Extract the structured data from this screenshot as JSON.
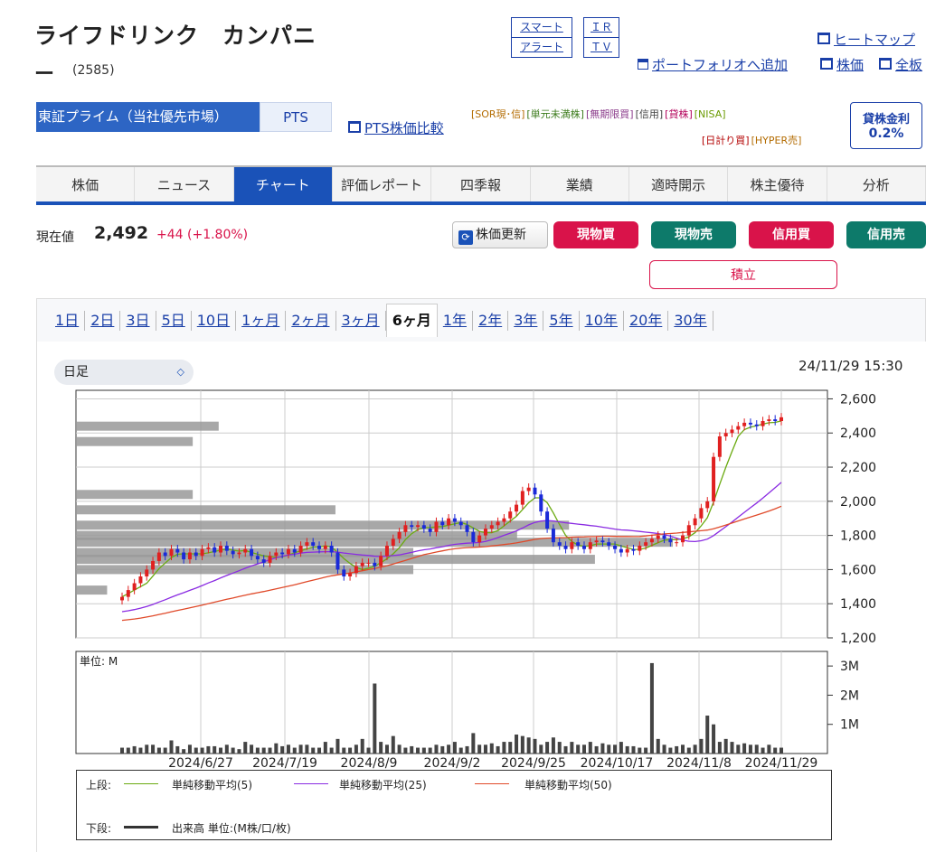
{
  "header": {
    "company_name_line1": "ライフドリンク　カンパニ",
    "company_name_line2": "ー",
    "code": "(2585)",
    "smart_alert_1": "スマート",
    "smart_alert_2": "アラート",
    "ir_1": "ＩＲ",
    "ir_2": "ＴＶ",
    "heatmap": "ヒートマップ",
    "portfolio_add": "ポートフォリオへ追加",
    "stock_price_link": "株価",
    "all_link": "全板"
  },
  "market": {
    "primary": "東証プライム（当社優先市場）",
    "pts": "PTS",
    "pts_compare": "PTS株価比較"
  },
  "tags": {
    "row1": [
      "[SOR現･信]",
      "[単元未満株]",
      "[無期限買]",
      "[信用]",
      "[貸株]",
      "[NISA]"
    ],
    "row2": [
      "[日計り買]",
      "[HYPER売]"
    ],
    "row1_colors": [
      "#b36b00",
      "#3a7a1a",
      "#8a3a8a",
      "#444",
      "#b3005a",
      "#6a9a00"
    ],
    "row2_colors": [
      "#b30000",
      "#b36b00"
    ]
  },
  "lending": {
    "label": "貸株金利",
    "value": "0.2%"
  },
  "tabs": [
    {
      "label": "株価",
      "active": false
    },
    {
      "label": "ニュース",
      "active": false
    },
    {
      "label": "チャート",
      "active": true
    },
    {
      "label": "評価レポート",
      "active": false
    },
    {
      "label": "四季報",
      "active": false
    },
    {
      "label": "業績",
      "active": false
    },
    {
      "label": "適時開示",
      "active": false
    },
    {
      "label": "株主優待",
      "active": false
    },
    {
      "label": "分析",
      "active": false
    }
  ],
  "quote": {
    "label": "現在値",
    "price": "2,492",
    "change": "+44 (+1.80%)"
  },
  "actions": {
    "refresh": "株価更新",
    "spot_buy": "現物買",
    "spot_sell": "現物売",
    "margin_buy": "信用買",
    "margin_sell": "信用売",
    "accumulate": "積立"
  },
  "colors": {
    "buy": "#d9134a",
    "sell": "#0d7a6a",
    "accent": "#1a52b8"
  },
  "ranges": [
    {
      "label": "1日",
      "active": false
    },
    {
      "label": "2日",
      "active": false
    },
    {
      "label": "3日",
      "active": false
    },
    {
      "label": "5日",
      "active": false
    },
    {
      "label": "10日",
      "active": false
    },
    {
      "label": "1ヶ月",
      "active": false
    },
    {
      "label": "2ヶ月",
      "active": false
    },
    {
      "label": "3ヶ月",
      "active": false
    },
    {
      "label": "6ヶ月",
      "active": true
    },
    {
      "label": "1年",
      "active": false
    },
    {
      "label": "2年",
      "active": false
    },
    {
      "label": "3年",
      "active": false
    },
    {
      "label": "5年",
      "active": false
    },
    {
      "label": "10年",
      "active": false
    },
    {
      "label": "20年",
      "active": false
    },
    {
      "label": "30年",
      "active": false
    }
  ],
  "chart_controls": {
    "interval": "日足",
    "timestamp": "24/11/29 15:30"
  },
  "chart_data": {
    "type": "candlestick",
    "x_ticks": [
      "2024/6/27",
      "2024/7/19",
      "2024/8/9",
      "2024/9/2",
      "2024/9/25",
      "2024/10/17",
      "2024/11/8",
      "2024/11/29"
    ],
    "price_ticks": [
      "2,600",
      "2,400",
      "2,200",
      "2,000",
      "1,800",
      "1,600",
      "1,400",
      "1,200"
    ],
    "ylim": [
      1200,
      2650
    ],
    "volume_unit_label": "単位: M",
    "volume_ticks": [
      "3M",
      "2M",
      "1M"
    ],
    "volume_ylim": [
      0,
      3.5
    ],
    "closes": [
      1440,
      1480,
      1520,
      1560,
      1600,
      1650,
      1700,
      1680,
      1720,
      1700,
      1660,
      1700,
      1680,
      1720,
      1730,
      1700,
      1740,
      1710,
      1690,
      1700,
      1720,
      1680,
      1660,
      1640,
      1680,
      1700,
      1690,
      1720,
      1700,
      1740,
      1760,
      1740,
      1720,
      1740,
      1700,
      1600,
      1560,
      1580,
      1620,
      1640,
      1640,
      1620,
      1680,
      1740,
      1780,
      1820,
      1860,
      1850,
      1860,
      1840,
      1820,
      1880,
      1860,
      1900,
      1880,
      1860,
      1820,
      1760,
      1800,
      1840,
      1860,
      1880,
      1900,
      1940,
      1980,
      2060,
      2080,
      2040,
      1940,
      1840,
      1760,
      1740,
      1720,
      1760,
      1740,
      1720,
      1760,
      1770,
      1760,
      1740,
      1720,
      1700,
      1720,
      1710,
      1740,
      1760,
      1780,
      1800,
      1780,
      1760,
      1760,
      1800,
      1860,
      1900,
      1960,
      2000,
      2260,
      2380,
      2400,
      2420,
      2440,
      2460,
      2450,
      2440,
      2470,
      2480,
      2470,
      2492
    ],
    "volumes": [
      0.2,
      0.2,
      0.25,
      0.2,
      0.3,
      0.3,
      0.2,
      0.2,
      0.45,
      0.25,
      0.15,
      0.3,
      0.2,
      0.2,
      0.25,
      0.25,
      0.2,
      0.3,
      0.2,
      0.15,
      0.4,
      0.3,
      0.2,
      0.2,
      0.2,
      0.35,
      0.25,
      0.3,
      0.2,
      0.3,
      0.3,
      0.2,
      0.2,
      0.4,
      0.2,
      0.5,
      0.2,
      0.2,
      0.3,
      0.5,
      0.2,
      2.4,
      0.4,
      0.3,
      0.6,
      0.3,
      0.2,
      0.25,
      0.2,
      0.2,
      0.2,
      0.3,
      0.25,
      0.3,
      0.4,
      0.2,
      0.25,
      0.7,
      0.3,
      0.3,
      0.35,
      0.25,
      0.4,
      0.4,
      0.65,
      0.6,
      0.55,
      0.5,
      0.3,
      0.4,
      0.55,
      0.4,
      0.25,
      0.4,
      0.3,
      0.3,
      0.4,
      0.25,
      0.35,
      0.3,
      0.3,
      0.4,
      0.25,
      0.25,
      0.2,
      0.2,
      3.1,
      0.5,
      0.3,
      0.2,
      0.25,
      0.3,
      0.2,
      0.3,
      0.5,
      1.3,
      1.0,
      0.4,
      0.5,
      0.4,
      0.3,
      0.35,
      0.3,
      0.3,
      0.2,
      0.3,
      0.2,
      0.2
    ],
    "ma5_color": "#6aaa10",
    "ma25_color": "#8a2be2",
    "ma50_color": "#e04a2a",
    "volume_profile": [
      {
        "price": 2440,
        "value": 0.55
      },
      {
        "price": 2350,
        "value": 0.45
      },
      {
        "price": 2040,
        "value": 0.45
      },
      {
        "price": 1950,
        "value": 1.0
      },
      {
        "price": 1860,
        "value": 1.9
      },
      {
        "price": 1800,
        "value": 1.7
      },
      {
        "price": 1760,
        "value": 2.3
      },
      {
        "price": 1700,
        "value": 1.3
      },
      {
        "price": 1660,
        "value": 2.0
      },
      {
        "price": 1600,
        "value": 1.3
      },
      {
        "price": 1480,
        "value": 0.12
      }
    ]
  },
  "legend": {
    "upper_label": "上段:",
    "ma5": "単純移動平均(5)",
    "ma25": "単純移動平均(25)",
    "ma50": "単純移動平均(50)",
    "lower_label": "下段:",
    "volume": "出来高 単位:(M株/口/枚)"
  }
}
